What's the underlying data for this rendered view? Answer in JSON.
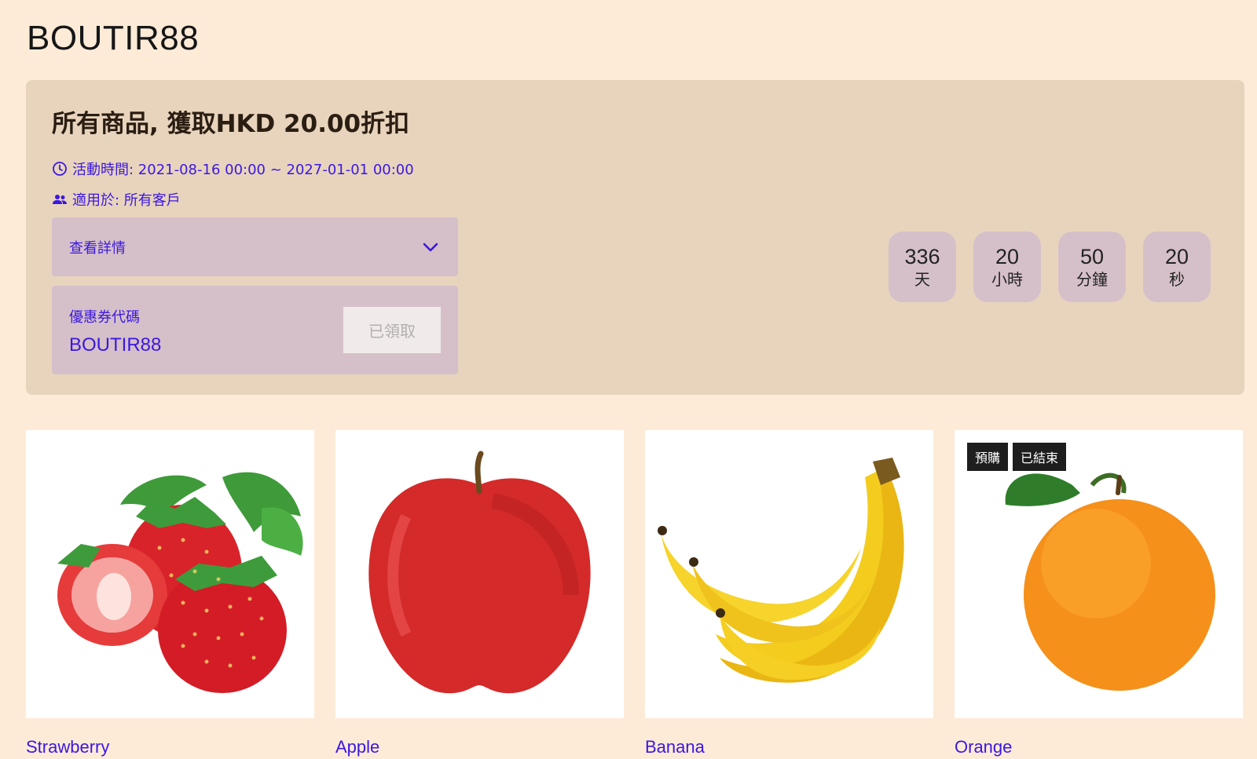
{
  "page": {
    "title": "BOUTIR88"
  },
  "promo": {
    "heading": "所有商品, 獲取HKD 20.00折扣",
    "time_text": "活動時間: 2021-08-16 00:00 ~ 2027-01-01 00:00",
    "apply_text": "適用於: 所有客戶",
    "details_label": "查看詳情",
    "coupon_caption": "優惠券代碼",
    "coupon_code": "BOUTIR88",
    "claim_button_label": "已領取"
  },
  "countdown": [
    {
      "value": "336",
      "label": "天"
    },
    {
      "value": "20",
      "label": "小時"
    },
    {
      "value": "50",
      "label": "分鐘"
    },
    {
      "value": "20",
      "label": "秒"
    }
  ],
  "products": [
    {
      "name": "Strawberry",
      "image": "strawberry-image",
      "badges": []
    },
    {
      "name": "Apple",
      "image": "apple-image",
      "badges": []
    },
    {
      "name": "Banana",
      "image": "banana-image",
      "badges": []
    },
    {
      "name": "Orange",
      "image": "orange-image",
      "badges": [
        "預購",
        "已結束"
      ]
    }
  ],
  "colors": {
    "background": "#fdebd8",
    "card": "#e8d4bd",
    "panel": "#d5c0c9",
    "accent": "#3b17e0"
  }
}
